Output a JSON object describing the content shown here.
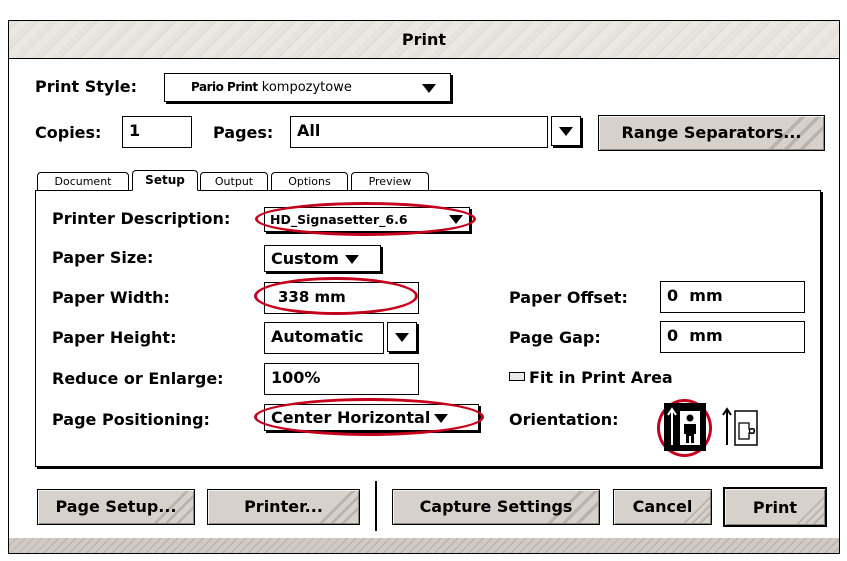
{
  "dialog": {
    "title": "Print"
  },
  "print_style": {
    "label": "Print Style:",
    "value_bold": "Pario Print",
    "value_rest": " kompozytowe"
  },
  "copies": {
    "label": "Copies:",
    "value": "1"
  },
  "pages": {
    "label": "Pages:",
    "value": "All"
  },
  "range_separators_label": "Range Separators...",
  "tabs": [
    {
      "label": "Document",
      "active": false
    },
    {
      "label": "Setup",
      "active": true
    },
    {
      "label": "Output",
      "active": false
    },
    {
      "label": "Options",
      "active": false
    },
    {
      "label": "Preview",
      "active": false
    }
  ],
  "setup": {
    "printer_description": {
      "label": "Printer Description:",
      "value": "HD_Signasetter_6.6"
    },
    "paper_size": {
      "label": "Paper Size:",
      "value": "Custom"
    },
    "paper_width": {
      "label": "Paper Width:",
      "value": "338 mm"
    },
    "paper_height": {
      "label": "Paper Height:",
      "value": "Automatic"
    },
    "reduce_enlarge": {
      "label": "Reduce or Enlarge:",
      "value": "100%"
    },
    "page_positioning": {
      "label": "Page Positioning:",
      "value": "Center Horizontal"
    },
    "paper_offset": {
      "label": "Paper Offset:",
      "value": "0  mm"
    },
    "page_gap": {
      "label": "Page Gap:",
      "value": "0  mm"
    },
    "fit_in_print_area": {
      "label": "Fit in Print Area",
      "checked": false
    },
    "orientation": {
      "label": "Orientation:",
      "selected": "portrait"
    }
  },
  "buttons": {
    "page_setup": "Page Setup...",
    "printer": "Printer...",
    "capture_settings": "Capture Settings",
    "cancel": "Cancel",
    "print": "Print"
  },
  "colors": {
    "highlight": "#c4001d",
    "button_face": "#d6d1cb"
  }
}
